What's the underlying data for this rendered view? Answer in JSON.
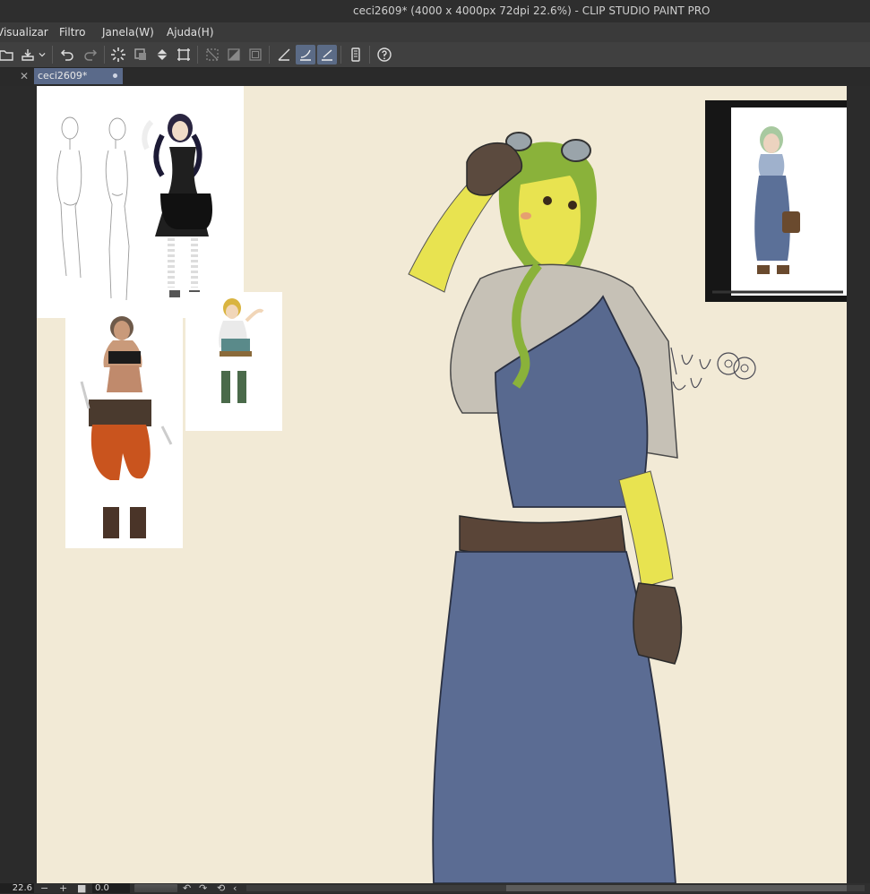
{
  "window": {
    "title": "ceci2609* (4000 x 4000px 72dpi 22.6%)  - CLIP STUDIO PAINT PRO"
  },
  "menu": {
    "items": [
      "Visualizar",
      "Filtro",
      "Janela(W)",
      "Ajuda(H)"
    ]
  },
  "toolbar": {
    "icons": [
      "open-file-icon",
      "save-icon",
      "dropdown-icon",
      "undo-icon",
      "redo-icon",
      "loading-icon",
      "clear-icon",
      "fill-icon",
      "transform-icon",
      "deselect-icon",
      "invert-selection-icon",
      "selection-border-icon",
      "snap-ruler-icon",
      "snap-special-ruler-icon",
      "snap-grid-icon",
      "tablet-icon",
      "help-icon"
    ]
  },
  "tabs": {
    "active_tab": "ceci2609*"
  },
  "canvas": {
    "background_color": "#f2ead6",
    "sketch_note": "Livu"
  },
  "status": {
    "zoom": "22.6",
    "zoom_out": "−",
    "zoom_in": "+",
    "angle": "0.0"
  }
}
